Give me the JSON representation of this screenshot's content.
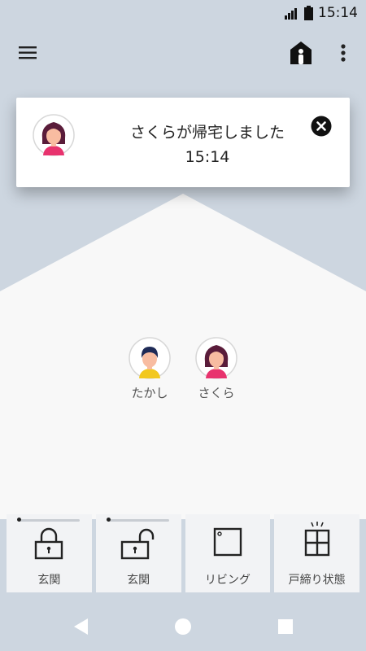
{
  "status_bar": {
    "time": "15:14"
  },
  "app_bar": {
    "menu_icon": "hamburger-menu-icon",
    "home_icon": "house-person-icon",
    "more_icon": "more-vertical-icon"
  },
  "notification": {
    "title": "さくらが帰宅しました",
    "time": "15:14",
    "close_icon": "close-circle-icon"
  },
  "members": [
    {
      "name": "たかし",
      "hair": "#1e2a56",
      "shirt": "#f2c81e"
    },
    {
      "name": "さくら",
      "hair": "#5a1c3a",
      "shirt": "#e8336e"
    }
  ],
  "tiles": [
    {
      "label": "玄関",
      "icon": "lock-closed-icon"
    },
    {
      "label": "玄関",
      "icon": "lock-open-icon"
    },
    {
      "label": "リビング",
      "icon": "window-sensor-icon"
    },
    {
      "label": "戸締り状態",
      "icon": "window-lock-status-icon"
    }
  ],
  "colors": {
    "background": "#cdd6e0",
    "house": "#f8f8f8",
    "tile": "#f2f3f5"
  }
}
